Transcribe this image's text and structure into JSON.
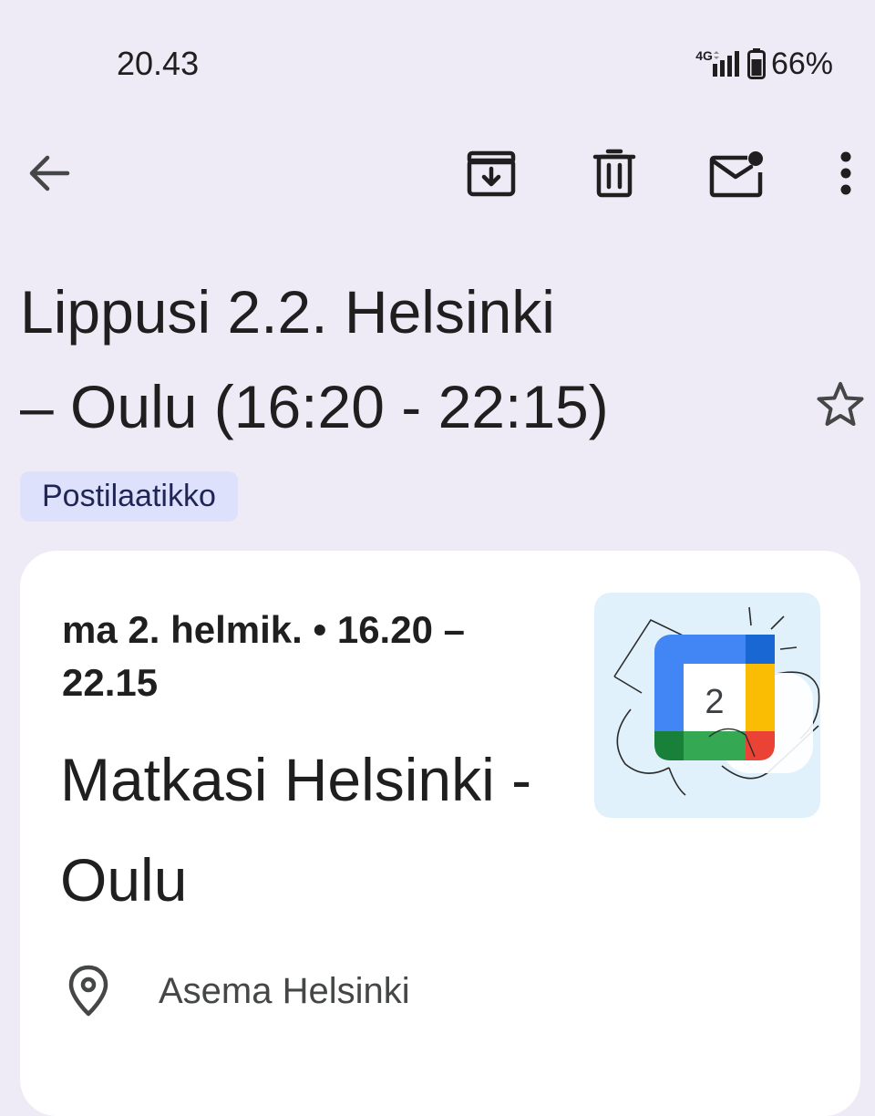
{
  "status_bar": {
    "time": "20.43",
    "network": "4G",
    "battery": "66%"
  },
  "toolbar": {
    "icons": [
      "back-arrow-icon",
      "archive-icon",
      "delete-icon",
      "mark-unread-icon",
      "more-vert-icon"
    ]
  },
  "email": {
    "subject_line1": "Lippusi 2.2. Helsinki",
    "subject_line2": "– Oulu (16:20 - 22:15)",
    "label": "Postilaatikko"
  },
  "event_card": {
    "when_line1": "ma 2. helmik. • 16.20 –",
    "when_line2": "22.15",
    "title_line1": "Matkasi Helsinki -",
    "title_line2": "Oulu",
    "location": "Asema Helsinki",
    "thumbnail_day": "2"
  },
  "colors": {
    "background": "#eeeaf6",
    "chip": "#dde1fb",
    "card": "#ffffff",
    "calendar_blue": "#4285f4",
    "calendar_green": "#34a853",
    "calendar_yellow": "#fbbc04",
    "calendar_red": "#ea4335"
  }
}
